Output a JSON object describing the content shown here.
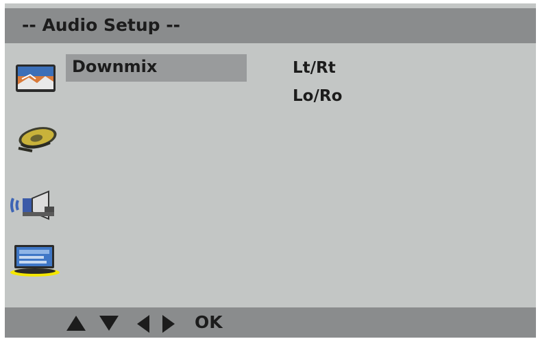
{
  "header": {
    "title": "-- Audio Setup --"
  },
  "sidebar": {
    "icons": [
      {
        "name": "general-setup-icon"
      },
      {
        "name": "speaker-setup-icon"
      },
      {
        "name": "audio-setup-icon"
      },
      {
        "name": "preferences-icon",
        "selected": true
      }
    ]
  },
  "menu": {
    "items": [
      {
        "label": "Downmix",
        "highlighted": true
      }
    ]
  },
  "options": {
    "items": [
      {
        "label": "Lt/Rt"
      },
      {
        "label": "Lo/Ro"
      }
    ]
  },
  "footer": {
    "nav_icons": [
      "up-arrow-icon",
      "down-arrow-icon",
      "left-arrow-icon",
      "right-arrow-icon"
    ],
    "ok_label": "OK"
  },
  "colors": {
    "background": "#c3c6c5",
    "bars": "#8a8c8d",
    "highlight": "#999b9c",
    "selection_underline": "#f4e600"
  }
}
